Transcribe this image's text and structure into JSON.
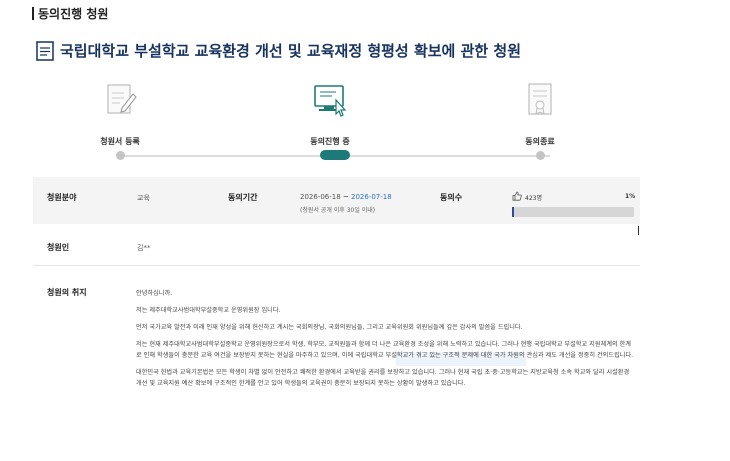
{
  "section": {
    "title": "동의진행 청원"
  },
  "petition": {
    "title": "국립대학교 부설학교 교육환경 개선 및 교육재정 형평성 확보에 관한 청원"
  },
  "steps": [
    {
      "label": "청원서 등록",
      "icon": "edit-document-icon",
      "state": "done"
    },
    {
      "label": "동의진행 중",
      "icon": "computer-click-icon",
      "state": "current"
    },
    {
      "label": "동의종료",
      "icon": "certificate-icon",
      "state": "pending"
    }
  ],
  "info": {
    "field_label": "청원분야",
    "field_value": "교육",
    "period_label": "동의기간",
    "period_start": "2026-06-18",
    "period_sep": " ~ ",
    "period_end": "2026-07-18",
    "period_note": "(청원서 공개 이후 30일 이내)",
    "agree_label": "동의수",
    "agree_count": "423명",
    "agree_percent": "1%",
    "agree_fraction": 0.01,
    "petitioner_label": "청원인",
    "petitioner_value": "김**",
    "purpose_label": "청원의 취지"
  },
  "body": {
    "p1": "안녕하십니까.",
    "p2": "저는 제주대학교사범대학부설중학교 운영위원장 입니다.",
    "p3": "먼저 국가교육 발전과 미래 인재 양성을 위해 헌신하고 계시는 국회의장님, 국회의원님들, 그리고 교육위원회 위원님들께 깊은 감사의 말씀을 드립니다.",
    "p4": "저는 현재 제주대학교사범대학부설중학교 운영위원장으로서 학생, 학부모, 교직원들과 함께 더 나은 교육환경 조성을 위해 노력하고 있습니다. 그러나 현행 국립대학교 부설학교 지원체계의 한계로 인해 학생들이 충분한 교육 여건을 보장받지 못하는 현실을 마주하고 있으며, 이에 국립대학교 부설학교가 겪고 있는 구조적 문제에 대한 국가 차원의 관심과 제도 개선을 정중히 건의드립니다.",
    "p5": "대한민국 헌법과 교육기본법은 모든 학생이 차별 없이 안전하고 쾌적한 환경에서 교육받을 권리를 보장하고 있습니다. 그러나 현재 국립 초·중·고등학교는 지방교육청 소속 학교와 달리 시설환경 개선 및 교육지원 예산 확보에 구조적인 한계를 안고 있어 학생들의 교육권이 충분히 보장되지 못하는 상황이 발생하고 있습니다."
  },
  "colors": {
    "accent": "#1d7a78",
    "title": "#17335e",
    "progress": "#2f4a9a",
    "date_end": "#2d6fc4"
  }
}
